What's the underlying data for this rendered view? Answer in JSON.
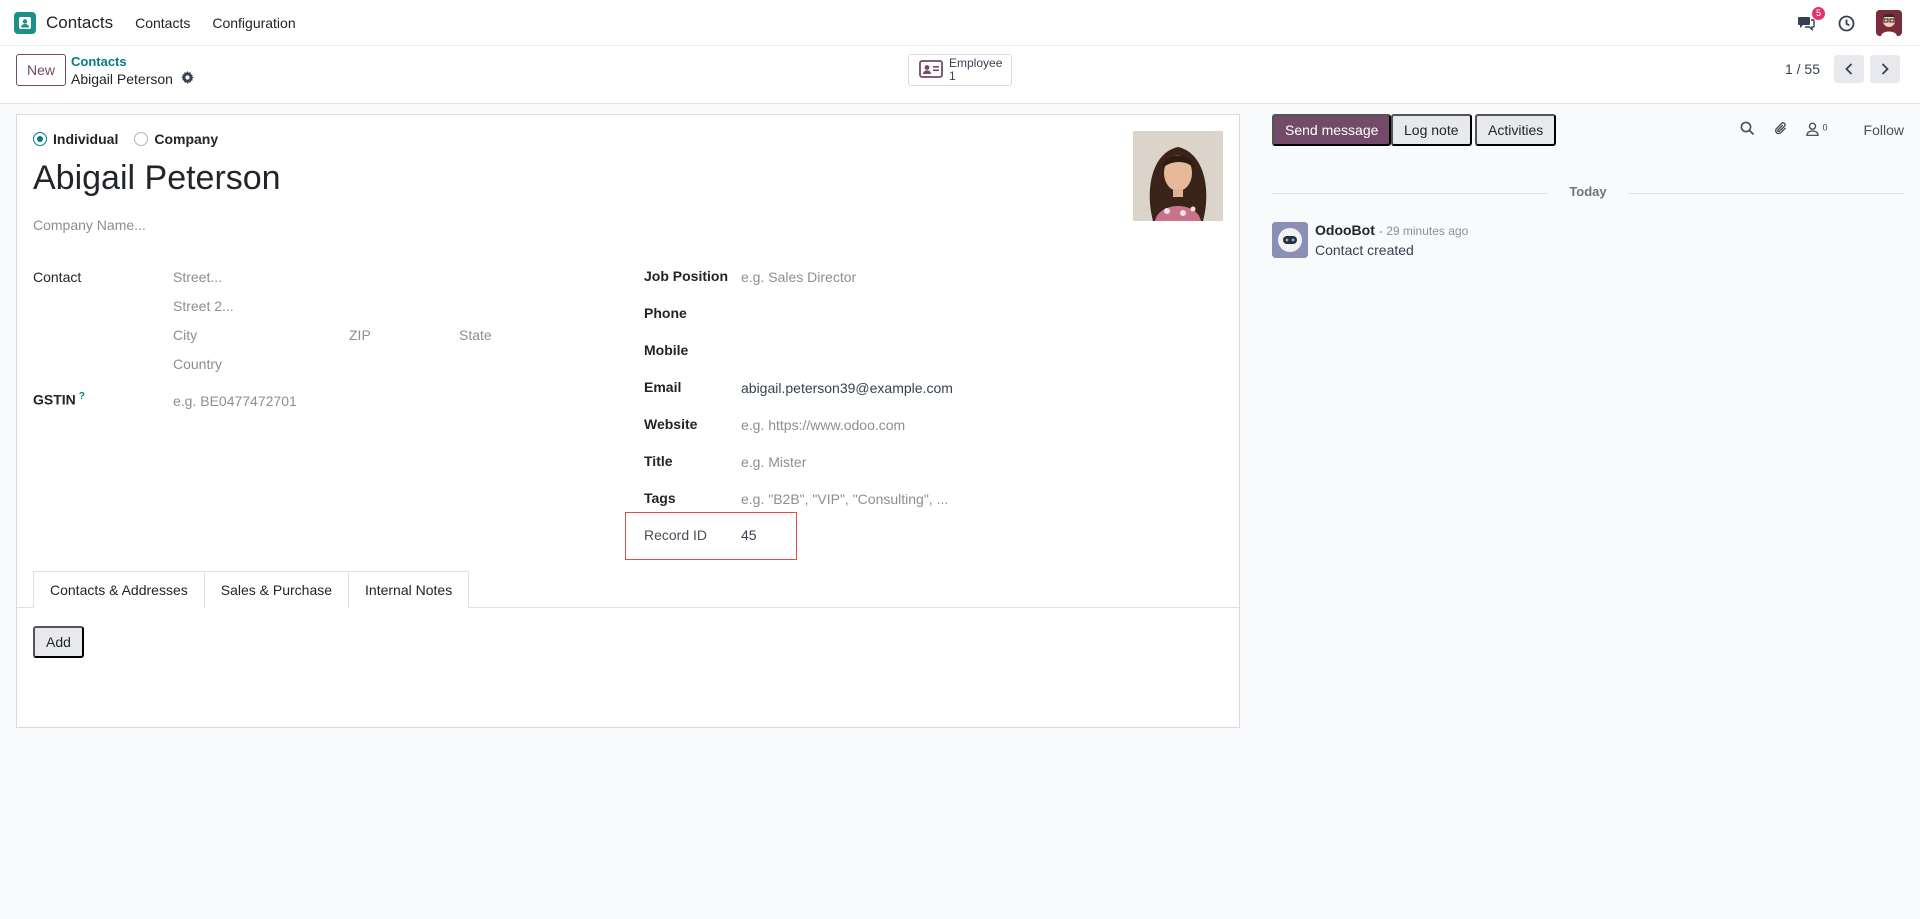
{
  "navbar": {
    "app_name": "Contacts",
    "menus": [
      "Contacts",
      "Configuration"
    ],
    "messages_badge": "5"
  },
  "control": {
    "new_label": "New",
    "breadcrumb_parent": "Contacts",
    "breadcrumb_current": "Abigail Peterson",
    "smart_button_label": "Employee",
    "smart_button_count": "1",
    "pager": "1 / 55"
  },
  "form": {
    "type_options": [
      "Individual",
      "Company"
    ],
    "selected_type": "Individual",
    "name": "Abigail Peterson",
    "company_placeholder": "Company Name...",
    "contact_label": "Contact",
    "street_placeholder": "Street...",
    "street2_placeholder": "Street 2...",
    "city_placeholder": "City",
    "zip_placeholder": "ZIP",
    "state_placeholder": "State",
    "country_placeholder": "Country",
    "gstin_label": "GSTIN",
    "gstin_help": "?",
    "gstin_placeholder": "e.g. BE0477472701",
    "job_position_label": "Job Position",
    "job_position_placeholder": "e.g. Sales Director",
    "phone_label": "Phone",
    "mobile_label": "Mobile",
    "email_label": "Email",
    "email_value": "abigail.peterson39@example.com",
    "website_label": "Website",
    "website_placeholder": "e.g. https://www.odoo.com",
    "title_label": "Title",
    "title_placeholder": "e.g. Mister",
    "tags_label": "Tags",
    "tags_placeholder": "e.g. \"B2B\", \"VIP\", \"Consulting\", ...",
    "record_id_label": "Record ID",
    "record_id_value": "45",
    "tabs": [
      "Contacts & Addresses",
      "Sales & Purchase",
      "Internal Notes"
    ],
    "active_tab": "Contacts & Addresses",
    "add_label": "Add"
  },
  "chatter": {
    "send_message": "Send message",
    "log_note": "Log note",
    "activities": "Activities",
    "follower_count": "0",
    "follow": "Follow",
    "date_separator": "Today",
    "message_author": "OdooBot",
    "message_time": "- 29 minutes ago",
    "message_body": "Contact created"
  },
  "colors": {
    "primary": "#714b67",
    "accent": "#017e84",
    "highlight": "#e54b4b"
  }
}
